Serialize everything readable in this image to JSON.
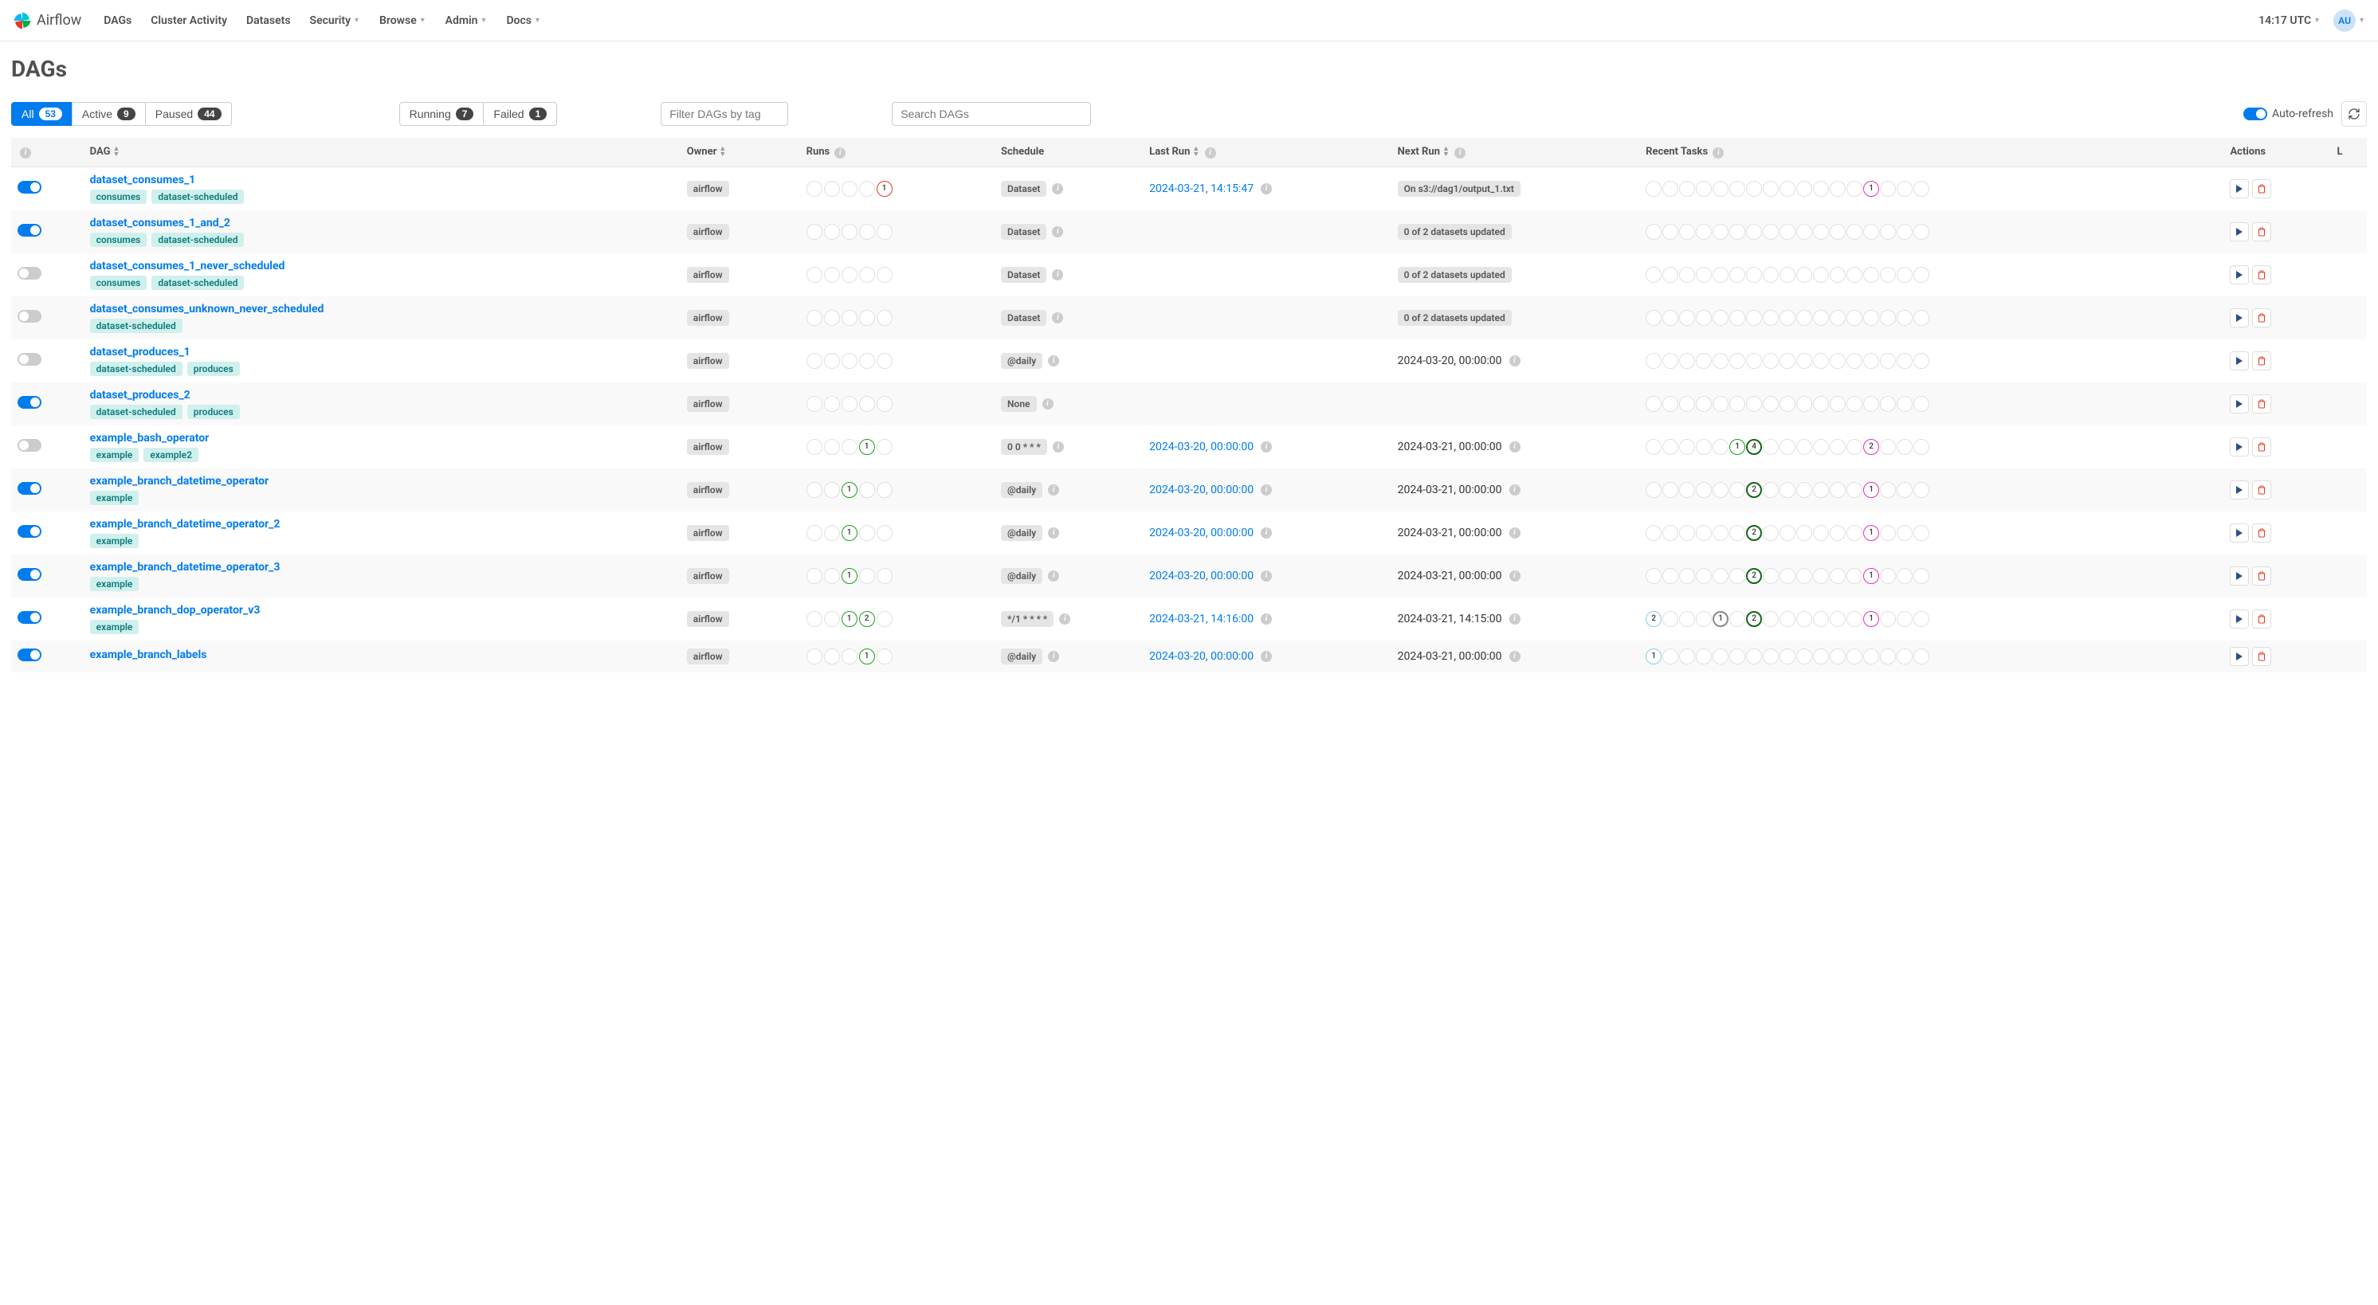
{
  "brand": "Airflow",
  "nav": {
    "items": [
      "DAGs",
      "Cluster Activity",
      "Datasets",
      "Security",
      "Browse",
      "Admin",
      "Docs"
    ],
    "dropdown": [
      false,
      false,
      false,
      true,
      true,
      true,
      true
    ]
  },
  "clock": "14:17 UTC",
  "avatarInitials": "AU",
  "title": "DAGs",
  "statusFilters": [
    {
      "label": "All",
      "count": "53",
      "active": true
    },
    {
      "label": "Active",
      "count": "9",
      "active": false
    },
    {
      "label": "Paused",
      "count": "44",
      "active": false
    }
  ],
  "runStateFilters": [
    {
      "label": "Running",
      "count": "7"
    },
    {
      "label": "Failed",
      "count": "1"
    }
  ],
  "tagFilterPlaceholder": "Filter DAGs by tag",
  "searchPlaceholder": "Search DAGs",
  "autoRefreshLabel": "Auto-refresh",
  "autoRefreshOn": true,
  "columns": {
    "dag": "DAG",
    "owner": "Owner",
    "runs": "Runs",
    "schedule": "Schedule",
    "lastRun": "Last Run",
    "nextRun": "Next Run",
    "recent": "Recent Tasks",
    "actions": "Actions",
    "links": "L"
  },
  "rows": [
    {
      "enabled": true,
      "name": "dataset_consumes_1",
      "tags": [
        "consumes",
        "dataset-scheduled"
      ],
      "owner": "airflow",
      "runs": [
        null,
        null,
        null,
        null,
        {
          "n": "1",
          "style": "red"
        }
      ],
      "schedule": "Dataset",
      "lastRun": "2024-03-21, 14:15:47",
      "lastRunInfo": true,
      "nextRun": "On s3://dag1/output_1.txt",
      "nextRunPill": true,
      "recent": [
        null,
        null,
        null,
        null,
        null,
        null,
        null,
        null,
        null,
        null,
        null,
        null,
        null,
        {
          "n": "1",
          "style": "pink"
        },
        null,
        null,
        null
      ]
    },
    {
      "enabled": true,
      "name": "dataset_consumes_1_and_2",
      "tags": [
        "consumes",
        "dataset-scheduled"
      ],
      "owner": "airflow",
      "runs": [
        null,
        null,
        null,
        null,
        null
      ],
      "schedule": "Dataset",
      "lastRun": "",
      "nextRun": "0 of 2 datasets updated",
      "nextRunPill": true,
      "recent": [
        null,
        null,
        null,
        null,
        null,
        null,
        null,
        null,
        null,
        null,
        null,
        null,
        null,
        null,
        null,
        null,
        null
      ]
    },
    {
      "enabled": false,
      "name": "dataset_consumes_1_never_scheduled",
      "tags": [
        "consumes",
        "dataset-scheduled"
      ],
      "owner": "airflow",
      "runs": [
        null,
        null,
        null,
        null,
        null
      ],
      "schedule": "Dataset",
      "lastRun": "",
      "nextRun": "0 of 2 datasets updated",
      "nextRunPill": true,
      "recent": [
        null,
        null,
        null,
        null,
        null,
        null,
        null,
        null,
        null,
        null,
        null,
        null,
        null,
        null,
        null,
        null,
        null
      ]
    },
    {
      "enabled": false,
      "name": "dataset_consumes_unknown_never_scheduled",
      "tags": [
        "dataset-scheduled"
      ],
      "owner": "airflow",
      "runs": [
        null,
        null,
        null,
        null,
        null
      ],
      "schedule": "Dataset",
      "lastRun": "",
      "nextRun": "0 of 2 datasets updated",
      "nextRunPill": true,
      "recent": [
        null,
        null,
        null,
        null,
        null,
        null,
        null,
        null,
        null,
        null,
        null,
        null,
        null,
        null,
        null,
        null,
        null
      ]
    },
    {
      "enabled": false,
      "name": "dataset_produces_1",
      "tags": [
        "dataset-scheduled",
        "produces"
      ],
      "owner": "airflow",
      "runs": [
        null,
        null,
        null,
        null,
        null
      ],
      "schedule": "@daily",
      "lastRun": "",
      "nextRun": "2024-03-20, 00:00:00",
      "nextRunInfo": true,
      "recent": [
        null,
        null,
        null,
        null,
        null,
        null,
        null,
        null,
        null,
        null,
        null,
        null,
        null,
        null,
        null,
        null,
        null
      ]
    },
    {
      "enabled": true,
      "name": "dataset_produces_2",
      "tags": [
        "dataset-scheduled",
        "produces"
      ],
      "owner": "airflow",
      "runs": [
        null,
        null,
        null,
        null,
        null
      ],
      "schedule": "None",
      "lastRun": "",
      "nextRun": "",
      "recent": [
        null,
        null,
        null,
        null,
        null,
        null,
        null,
        null,
        null,
        null,
        null,
        null,
        null,
        null,
        null,
        null,
        null
      ]
    },
    {
      "enabled": false,
      "name": "example_bash_operator",
      "tags": [
        "example",
        "example2"
      ],
      "owner": "airflow",
      "runs": [
        null,
        null,
        null,
        {
          "n": "1",
          "style": "green"
        },
        null
      ],
      "schedule": "0 0 * * *",
      "lastRun": "2024-03-20, 00:00:00",
      "lastRunInfo": true,
      "nextRun": "2024-03-21, 00:00:00",
      "nextRunInfo": true,
      "recent": [
        null,
        null,
        null,
        null,
        null,
        {
          "n": "1",
          "style": "green"
        },
        {
          "n": "4",
          "style": "darkgreen"
        },
        null,
        null,
        null,
        null,
        null,
        null,
        {
          "n": "2",
          "style": "pink"
        },
        null,
        null,
        null
      ]
    },
    {
      "enabled": true,
      "name": "example_branch_datetime_operator",
      "tags": [
        "example"
      ],
      "owner": "airflow",
      "runs": [
        null,
        null,
        {
          "n": "1",
          "style": "green"
        },
        null,
        null
      ],
      "schedule": "@daily",
      "lastRun": "2024-03-20, 00:00:00",
      "lastRunInfo": true,
      "nextRun": "2024-03-21, 00:00:00",
      "nextRunInfo": true,
      "recent": [
        null,
        null,
        null,
        null,
        null,
        null,
        {
          "n": "2",
          "style": "darkgreen"
        },
        null,
        null,
        null,
        null,
        null,
        null,
        {
          "n": "1",
          "style": "pink"
        },
        null,
        null,
        null
      ]
    },
    {
      "enabled": true,
      "name": "example_branch_datetime_operator_2",
      "tags": [
        "example"
      ],
      "owner": "airflow",
      "runs": [
        null,
        null,
        {
          "n": "1",
          "style": "green"
        },
        null,
        null
      ],
      "schedule": "@daily",
      "lastRun": "2024-03-20, 00:00:00",
      "lastRunInfo": true,
      "nextRun": "2024-03-21, 00:00:00",
      "nextRunInfo": true,
      "recent": [
        null,
        null,
        null,
        null,
        null,
        null,
        {
          "n": "2",
          "style": "darkgreen"
        },
        null,
        null,
        null,
        null,
        null,
        null,
        {
          "n": "1",
          "style": "pink"
        },
        null,
        null,
        null
      ]
    },
    {
      "enabled": true,
      "name": "example_branch_datetime_operator_3",
      "tags": [
        "example"
      ],
      "owner": "airflow",
      "runs": [
        null,
        null,
        {
          "n": "1",
          "style": "green"
        },
        null,
        null
      ],
      "schedule": "@daily",
      "lastRun": "2024-03-20, 00:00:00",
      "lastRunInfo": true,
      "nextRun": "2024-03-21, 00:00:00",
      "nextRunInfo": true,
      "recent": [
        null,
        null,
        null,
        null,
        null,
        null,
        {
          "n": "2",
          "style": "darkgreen"
        },
        null,
        null,
        null,
        null,
        null,
        null,
        {
          "n": "1",
          "style": "pink"
        },
        null,
        null,
        null
      ]
    },
    {
      "enabled": true,
      "name": "example_branch_dop_operator_v3",
      "tags": [
        "example"
      ],
      "owner": "airflow",
      "runs": [
        null,
        null,
        {
          "n": "1",
          "style": "green"
        },
        {
          "n": "2",
          "style": "green"
        },
        null
      ],
      "schedule": "*/1 * * * *",
      "lastRun": "2024-03-21, 14:16:00",
      "lastRunInfo": true,
      "nextRun": "2024-03-21, 14:15:00",
      "nextRunInfo": true,
      "recent": [
        {
          "n": "2",
          "style": "lightblue"
        },
        null,
        null,
        null,
        {
          "n": "1",
          "style": "grey"
        },
        null,
        {
          "n": "2",
          "style": "darkgreen"
        },
        null,
        null,
        null,
        null,
        null,
        null,
        {
          "n": "1",
          "style": "pink"
        },
        null,
        null,
        null
      ]
    },
    {
      "enabled": true,
      "name": "example_branch_labels",
      "tags": [],
      "owner": "airflow",
      "runs": [
        null,
        null,
        null,
        {
          "n": "1",
          "style": "green"
        },
        null
      ],
      "schedule": "@daily",
      "lastRun": "2024-03-20, 00:00:00",
      "lastRunInfo": true,
      "nextRun": "2024-03-21, 00:00:00",
      "nextRunInfo": true,
      "recent": [
        {
          "n": "1",
          "style": "lightblue"
        },
        null,
        null,
        null,
        null,
        null,
        null,
        null,
        null,
        null,
        null,
        null,
        null,
        null,
        null,
        null,
        null
      ]
    }
  ]
}
